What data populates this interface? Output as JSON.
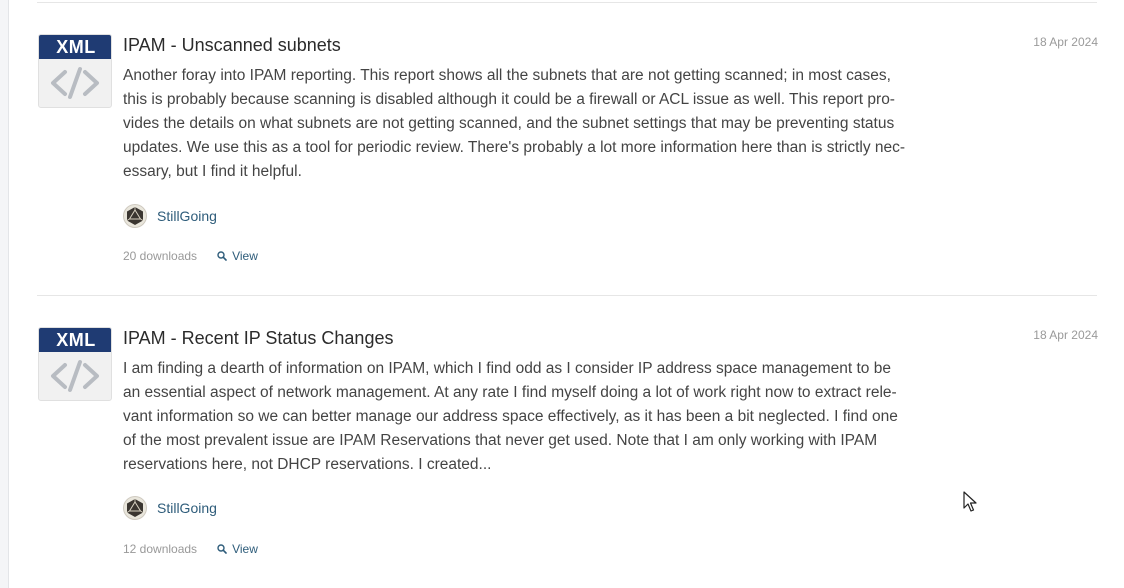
{
  "items": [
    {
      "file_type": "XML",
      "title": "IPAM - Unscanned subnets",
      "date": "18 Apr 2024",
      "description_lines": [
        "Another foray into IPAM reporting. This report shows all the subnets that are not getting scanned; in most cases,",
        "this is probably because scanning is disabled although it could be a firewall or ACL issue as well. This report pro-",
        "vides the details on what subnets are not getting scanned, and the subnet settings that may be preventing status",
        "updates. We use this as a tool for periodic review. There's probably a lot more information here than is strictly nec-",
        "essary, but I find it helpful."
      ],
      "author": "StillGoing",
      "downloads": "20 downloads",
      "view_label": "View"
    },
    {
      "file_type": "XML",
      "title": "IPAM - Recent IP Status Changes",
      "date": "18 Apr 2024",
      "description_lines": [
        "I am finding a dearth of information on IPAM, which I find odd as I consider IP address space management to be",
        "an essential aspect of network management. At any rate I find myself doing a lot of work right now to extract rele-",
        "vant information so we can better manage our address space effectively, as it has been a bit neglected. I find one",
        "of the most prevalent issue are IPAM Reservations that never get used. Note that I am only working with IPAM",
        "reservations here, not DHCP reservations. I created..."
      ],
      "author": "StillGoing",
      "downloads": "12 downloads",
      "view_label": "View"
    }
  ],
  "colors": {
    "icon_band": "#1f3b73",
    "link": "#2e5c7a",
    "muted": "#999999"
  },
  "icons": {
    "file": "xml-file-icon",
    "avatar": "d20-dice-avatar-icon",
    "view": "magnifier-icon",
    "cursor": "mouse-pointer-icon"
  }
}
